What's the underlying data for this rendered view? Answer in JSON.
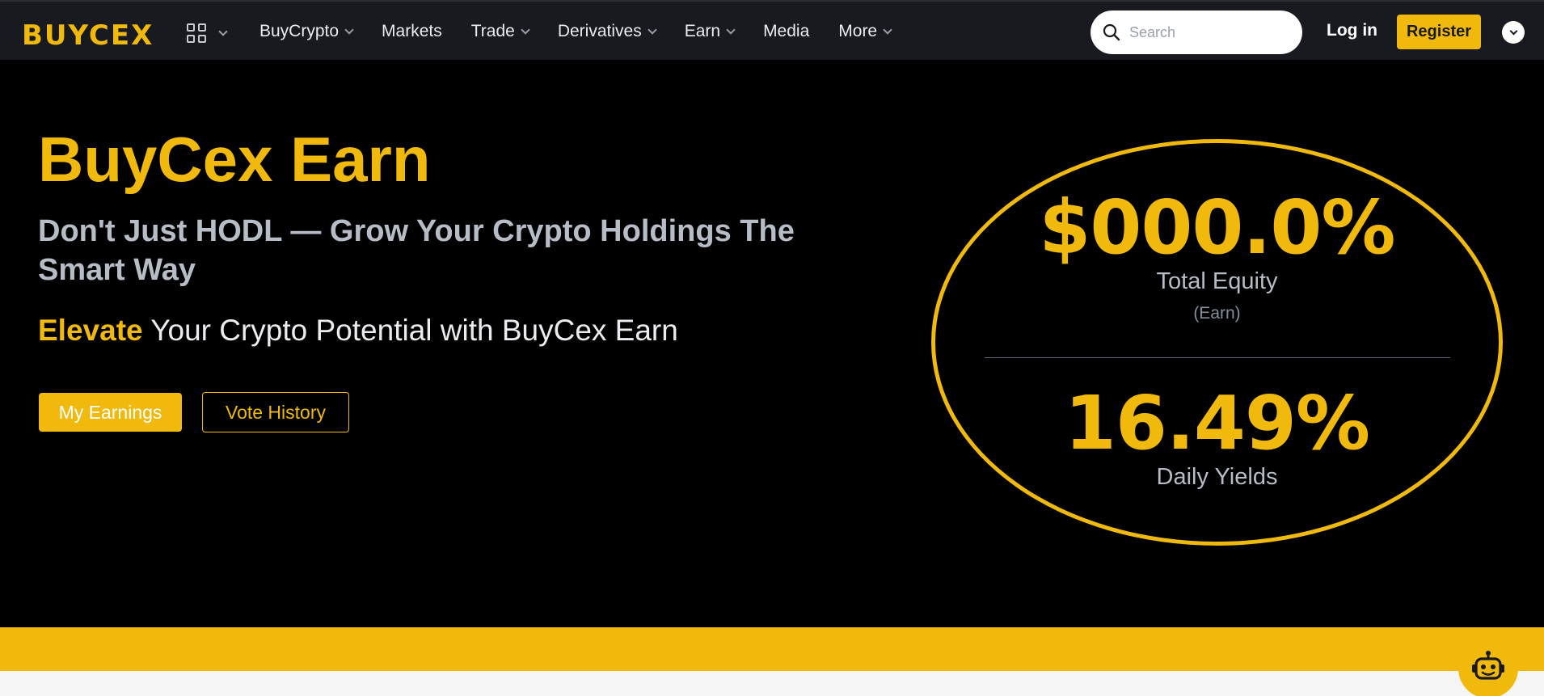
{
  "nav": {
    "logo": "BUYCEX",
    "items": [
      {
        "label": "BuyCrypto",
        "dropdown": true
      },
      {
        "label": "Markets",
        "dropdown": false
      },
      {
        "label": "Trade",
        "dropdown": true
      },
      {
        "label": "Derivatives",
        "dropdown": true
      },
      {
        "label": "Earn",
        "dropdown": true
      },
      {
        "label": "Media",
        "dropdown": false
      },
      {
        "label": "More",
        "dropdown": true
      }
    ],
    "search_placeholder": "Search",
    "login": "Log in",
    "register": "Register"
  },
  "hero": {
    "title": "BuyCex Earn",
    "subtitle": "Don't Just HODL — Grow Your Crypto Holdings The Smart Way",
    "tagline_highlight": "Elevate",
    "tagline_rest": " Your Crypto Potential with BuyCex Earn",
    "primary_button": "My Earnings",
    "secondary_button": "Vote History"
  },
  "stats": {
    "equity_value": "$000.0%",
    "equity_label": "Total Equity",
    "equity_note": "(Earn)",
    "yield_value": "16.49%",
    "yield_label": "Daily Yields"
  },
  "colors": {
    "accent": "#f0b90b",
    "nav_bg": "#181a20",
    "page_bg": "#000000"
  },
  "icons": {
    "apps": "apps-grid-icon",
    "search": "search-icon",
    "chevron": "chevron-down-icon",
    "assistant": "robot-icon"
  }
}
